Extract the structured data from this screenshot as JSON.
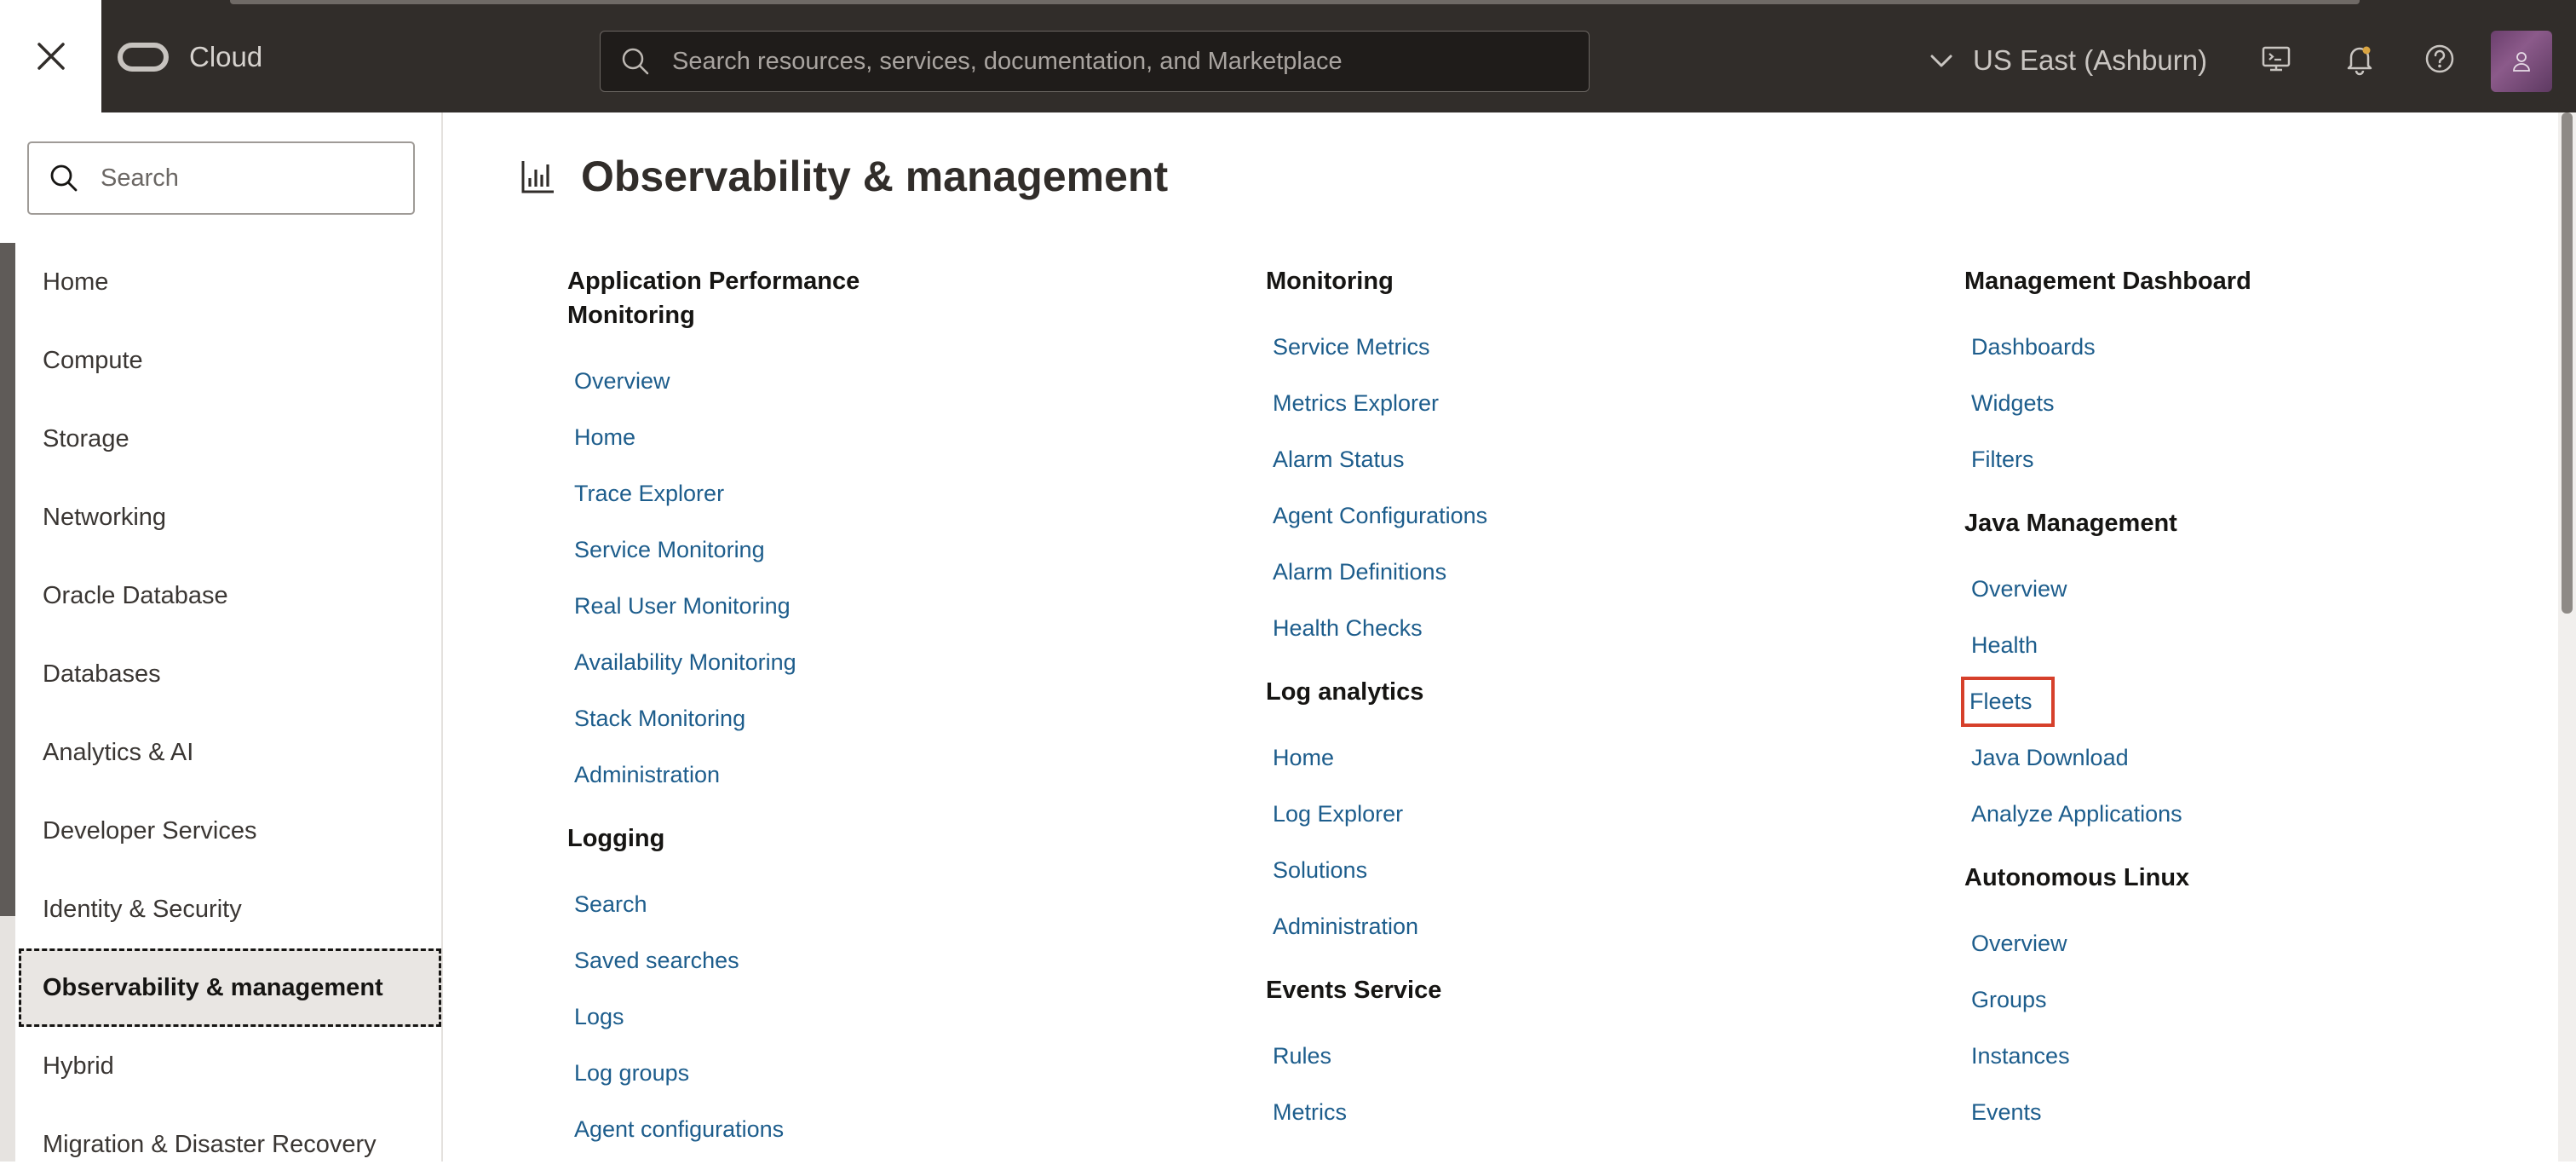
{
  "header": {
    "close_icon": "close-icon",
    "brand_name": "Cloud",
    "search_placeholder": "Search resources, services, documentation, and Marketplace",
    "region": "US East (Ashburn)",
    "icons": [
      "cloud-shell-icon",
      "bell-icon",
      "help-icon",
      "user-avatar-icon"
    ]
  },
  "sidebar": {
    "search_placeholder": "Search",
    "items": [
      {
        "label": "Home"
      },
      {
        "label": "Compute"
      },
      {
        "label": "Storage"
      },
      {
        "label": "Networking"
      },
      {
        "label": "Oracle Database"
      },
      {
        "label": "Databases"
      },
      {
        "label": "Analytics & AI"
      },
      {
        "label": "Developer Services"
      },
      {
        "label": "Identity & Security"
      },
      {
        "label": "Observability & management",
        "active": true
      },
      {
        "label": "Hybrid"
      },
      {
        "label": "Migration & Disaster Recovery"
      }
    ]
  },
  "main": {
    "title": "Observability & management",
    "title_icon": "chart-icon",
    "columns": [
      {
        "groups": [
          {
            "title_lines": [
              "Application Performance",
              "Monitoring"
            ],
            "links": [
              "Overview",
              "Home",
              "Trace Explorer",
              "Service Monitoring",
              "Real User Monitoring",
              "Availability Monitoring",
              "Stack Monitoring",
              "Administration"
            ]
          },
          {
            "title_lines": [
              "Logging"
            ],
            "links": [
              "Search",
              "Saved searches",
              "Logs",
              "Log groups",
              "Agent configurations"
            ]
          }
        ]
      },
      {
        "groups": [
          {
            "title_lines": [
              "Monitoring"
            ],
            "links": [
              "Service Metrics",
              "Metrics Explorer",
              "Alarm Status",
              "Agent Configurations",
              "Alarm Definitions",
              "Health Checks"
            ]
          },
          {
            "title_lines": [
              "Log analytics"
            ],
            "links": [
              "Home",
              "Log Explorer",
              "Solutions",
              "Administration"
            ]
          },
          {
            "title_lines": [
              "Events Service"
            ],
            "links": [
              "Rules",
              "Metrics"
            ]
          }
        ]
      },
      {
        "groups": [
          {
            "title_lines": [
              "Management Dashboard"
            ],
            "links": [
              "Dashboards",
              "Widgets",
              "Filters"
            ]
          },
          {
            "title_lines": [
              "Java Management"
            ],
            "links": [
              "Overview",
              "Health",
              "Fleets",
              "Java Download",
              "Analyze Applications"
            ],
            "highlighted": "Fleets"
          },
          {
            "title_lines": [
              "Autonomous Linux"
            ],
            "links": [
              "Overview",
              "Groups",
              "Instances",
              "Events"
            ]
          }
        ]
      }
    ]
  },
  "colors": {
    "header_bg": "#312d2a",
    "link": "#1d5d8c",
    "highlight_border": "#d6402b",
    "active_bg": "#e9e6e3"
  }
}
